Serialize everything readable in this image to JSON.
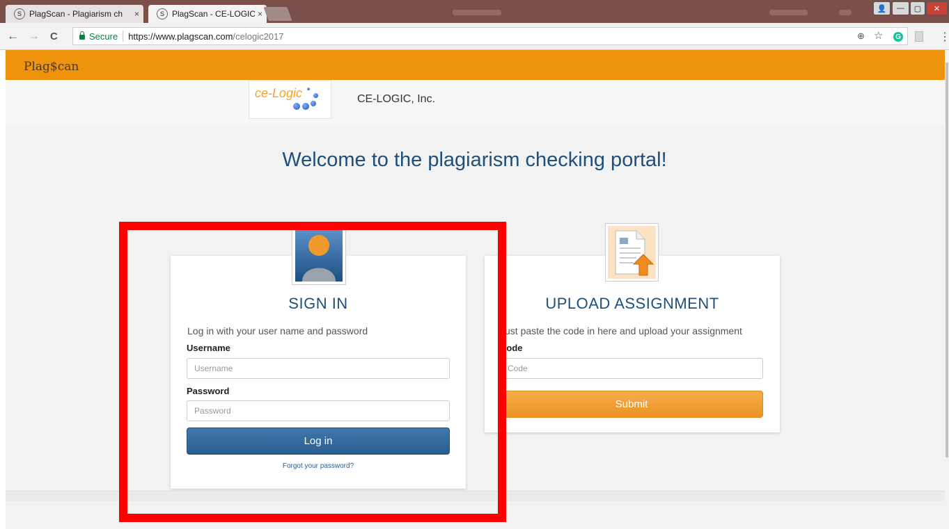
{
  "browser": {
    "tabs": [
      {
        "title": "PlagScan - Plagiarism ch",
        "active": false
      },
      {
        "title": "PlagScan - CE-LOGIC, Inc",
        "active": true
      }
    ],
    "tab_icon": "S",
    "tab_close": "×",
    "address": {
      "secure_label": "Secure",
      "url_host": "https://www.plagscan.com",
      "url_path": "/celogic2017"
    },
    "icons": [
      "back-icon",
      "forward-icon",
      "reload-icon",
      "lock-icon",
      "zoom-icon",
      "star-icon",
      "grammarly-icon",
      "pdf-icon",
      "menu-icon"
    ],
    "glyphs": {
      "back": "←",
      "forward": "→",
      "reload": "C",
      "zoom": "⊕",
      "star": "☆",
      "grammarly": "G",
      "menu": "⋮",
      "minimize": "—",
      "maximize": "▢",
      "close": "✕"
    }
  },
  "header": {
    "logo_text": "Plag$can",
    "bar_color": "#f0930c"
  },
  "organization": {
    "logo_text": "ce-Logic",
    "name": "CE-LOGIC, Inc."
  },
  "welcome": "Welcome to the plagiarism checking portal!",
  "signin": {
    "title": "SIGN IN",
    "subtitle": "Log in with your user name and password",
    "username_label": "Username",
    "username_placeholder": "Username",
    "password_label": "Password",
    "password_placeholder": "Password",
    "login_button": "Log in",
    "forgot_link": "Forgot your password?"
  },
  "upload": {
    "title": "UPLOAD ASSIGNMENT",
    "subtitle": "Just paste the code in here and upload your assignment",
    "code_label": "Code",
    "code_placeholder": "Code",
    "submit_button": "Submit"
  },
  "colors": {
    "primary_blue": "#2b5d8f",
    "accent_orange": "#ec9223",
    "title_blue": "#1f4f7a",
    "highlight_red": "#ff0000"
  }
}
